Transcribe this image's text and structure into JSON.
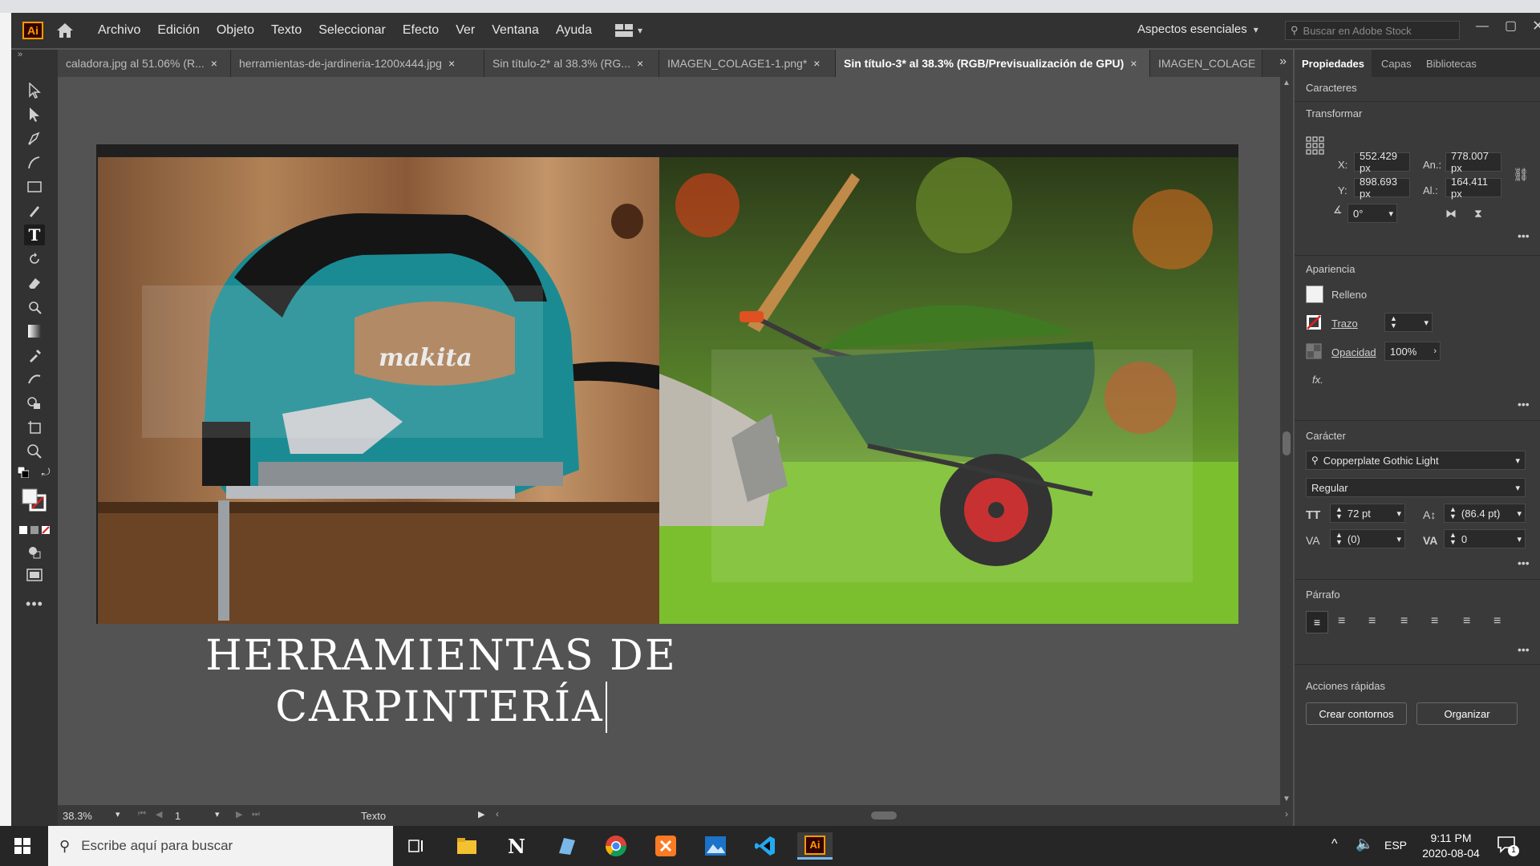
{
  "menu": {
    "app_logo": "Ai",
    "items": [
      "Archivo",
      "Edición",
      "Objeto",
      "Texto",
      "Seleccionar",
      "Efecto",
      "Ver",
      "Ventana",
      "Ayuda"
    ],
    "workspace": "Aspectos esenciales",
    "search_placeholder": "Buscar en Adobe Stock"
  },
  "tabs": [
    {
      "label": "caladora.jpg al 51.06% (R...",
      "close": "×"
    },
    {
      "label": "herramientas-de-jardineria-1200x444.jpg",
      "close": "×"
    },
    {
      "label": "Sin título-2* al 38.3% (RG...",
      "close": "×"
    },
    {
      "label": "IMAGEN_COLAGE1-1.png*",
      "close": "×"
    },
    {
      "label": "Sin título-3* al 38.3% (RGB/Previsualización de GPU)",
      "close": "×"
    },
    {
      "label": "IMAGEN_COLAGE",
      "close": ""
    }
  ],
  "canvas": {
    "headline_line1": "HERRAMIENTAS DE",
    "headline_line2": "CARPINTERÍA",
    "brand_text": "makita"
  },
  "status": {
    "zoom": "38.3%",
    "page": "1",
    "tool": "Texto"
  },
  "panel": {
    "tabs": [
      "Propiedades",
      "Capas",
      "Bibliotecas"
    ],
    "caracteres_title": "Caracteres",
    "transformar_title": "Transformar",
    "x_label": "X:",
    "x_value": "552.429 px",
    "y_label": "Y:",
    "y_value": "898.693 px",
    "w_label": "An.:",
    "w_value": "778.007 px",
    "h_label": "Al.:",
    "h_value": "164.411 px",
    "angle_value": "0°",
    "apariencia_title": "Apariencia",
    "relleno": "Relleno",
    "trazo": "Trazo",
    "opacidad": "Opacidad",
    "opacidad_value": "100%",
    "fx": "fx.",
    "caracter_title": "Carácter",
    "font_name": "Copperplate Gothic Light",
    "font_style": "Regular",
    "font_size": "72 pt",
    "leading": "(86.4 pt)",
    "kerning": "(0)",
    "tracking": "0",
    "parrafo_title": "Párrafo",
    "acciones_title": "Acciones rápidas",
    "btn_contornos": "Crear contornos",
    "btn_organizar": "Organizar"
  },
  "taskbar": {
    "search_placeholder": "Escribe aquí para buscar",
    "lang": "ESP",
    "time": "9:11 PM",
    "date": "2020-08-04",
    "notif_count": "1"
  }
}
